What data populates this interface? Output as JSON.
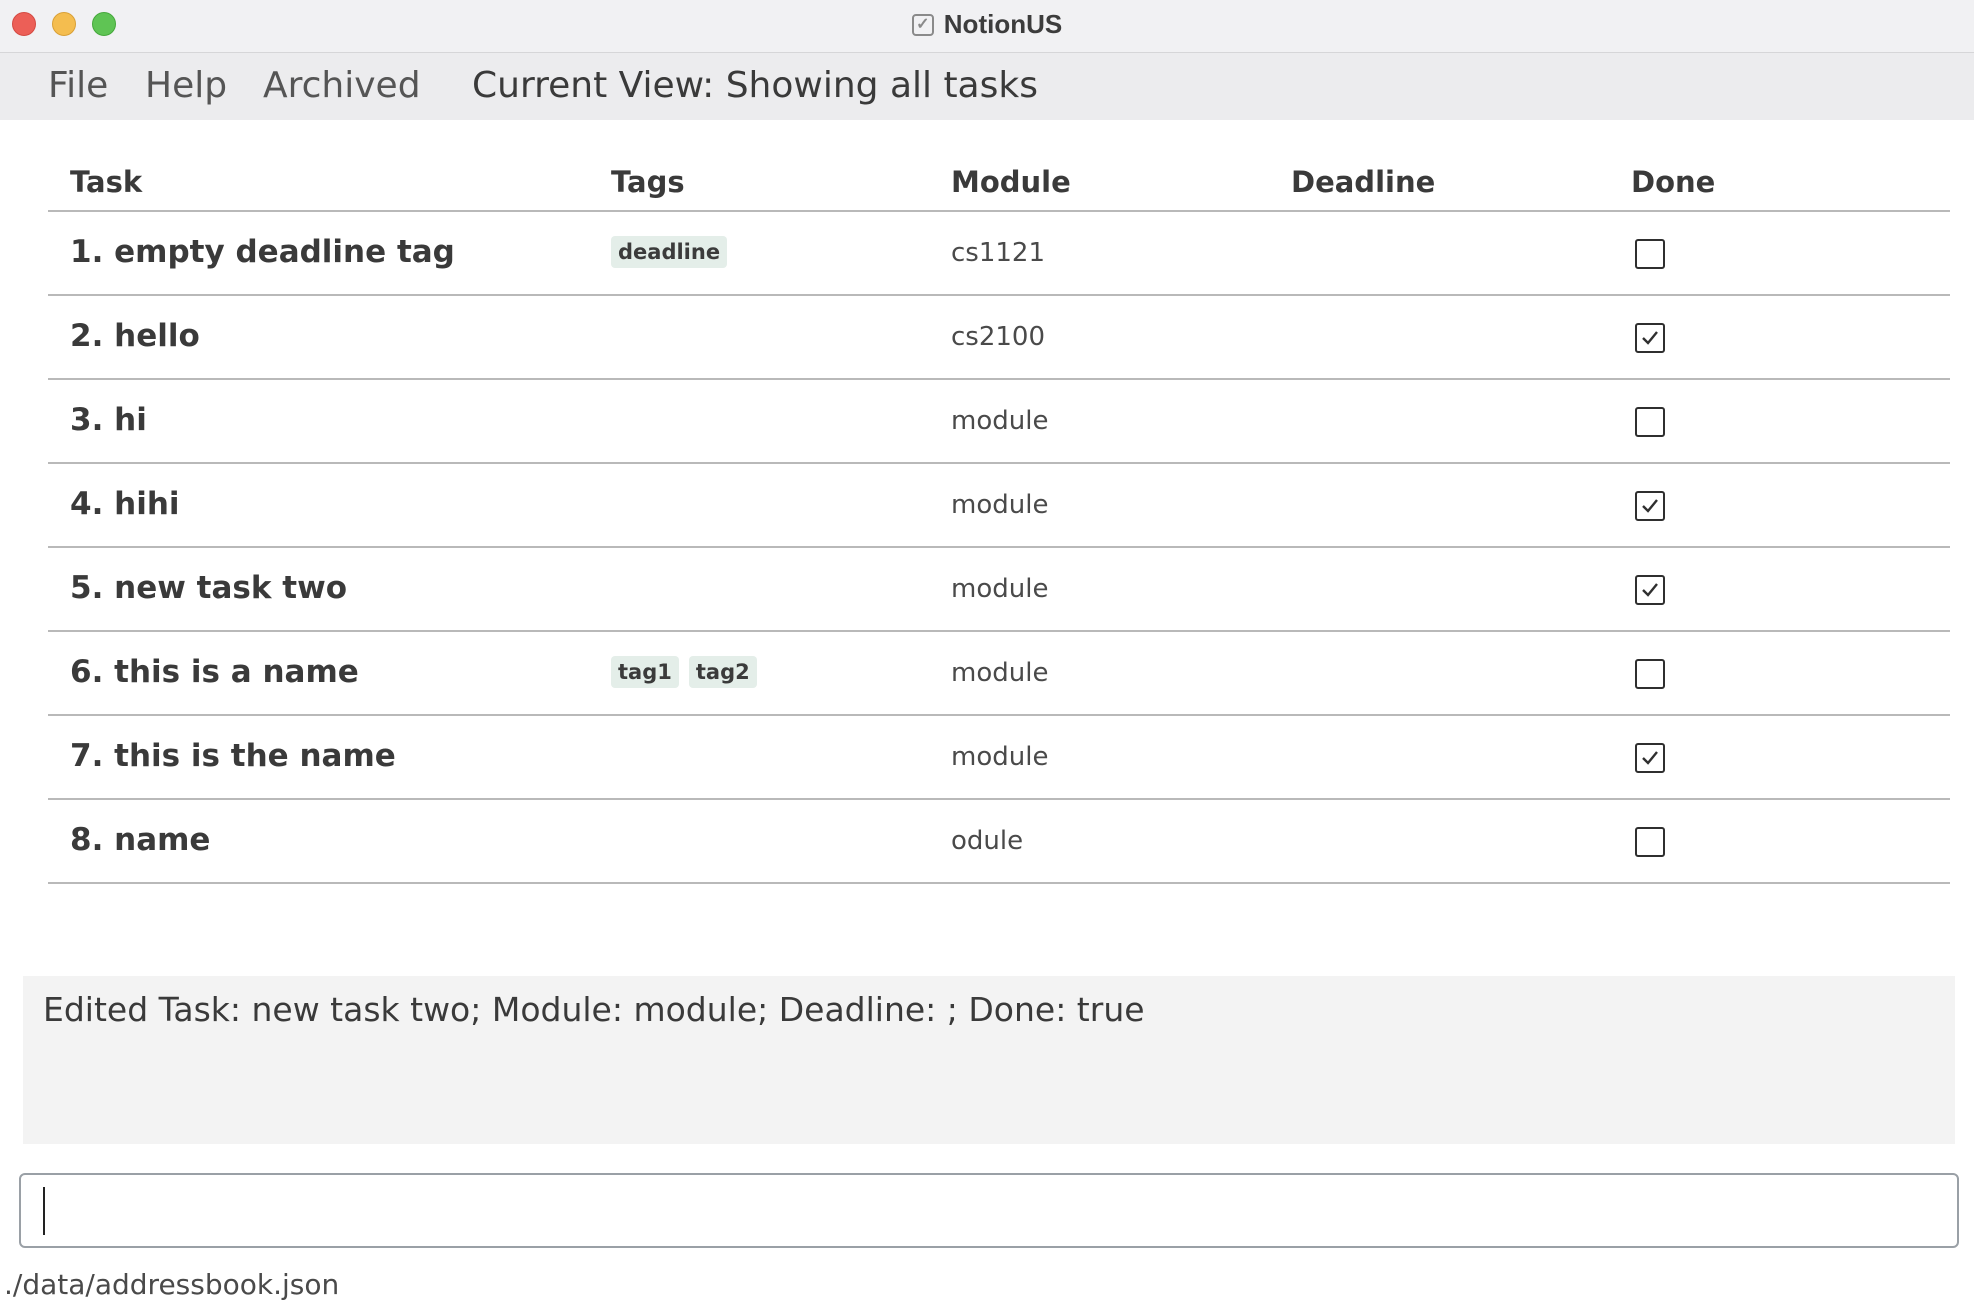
{
  "window": {
    "title": "NotionUS"
  },
  "menu": {
    "file": "File",
    "help": "Help",
    "archived": "Archived"
  },
  "current_view": "Current View: Showing all tasks",
  "table": {
    "headers": {
      "task": "Task",
      "tags": "Tags",
      "module": "Module",
      "deadline": "Deadline",
      "done": "Done"
    },
    "rows": [
      {
        "task": "1. empty deadline tag",
        "tags": [
          "deadline"
        ],
        "module": "cs1121",
        "deadline": "",
        "done": false
      },
      {
        "task": "2. hello",
        "tags": [],
        "module": "cs2100",
        "deadline": "",
        "done": true
      },
      {
        "task": "3. hi",
        "tags": [],
        "module": "module",
        "deadline": "",
        "done": false
      },
      {
        "task": "4. hihi",
        "tags": [],
        "module": "module",
        "deadline": "",
        "done": true
      },
      {
        "task": "5. new task two",
        "tags": [],
        "module": "module",
        "deadline": "",
        "done": true
      },
      {
        "task": "6. this is a name",
        "tags": [
          "tag1",
          "tag2"
        ],
        "module": "module",
        "deadline": "",
        "done": false
      },
      {
        "task": "7. this is the name",
        "tags": [],
        "module": "module",
        "deadline": "",
        "done": true
      },
      {
        "task": "8. name",
        "tags": [],
        "module": "odule",
        "deadline": "",
        "done": false
      }
    ]
  },
  "result_message": "Edited Task: new task two; Module: module; Deadline: ; Done: true",
  "command_input": {
    "value": "",
    "placeholder": ""
  },
  "status_bar": {
    "file_path": "./data/addressbook.json"
  },
  "colors": {
    "close": "#ec5f57",
    "minimize": "#f4bd4f",
    "maximize": "#5fc454",
    "tag_bg": "#e4eee9"
  }
}
